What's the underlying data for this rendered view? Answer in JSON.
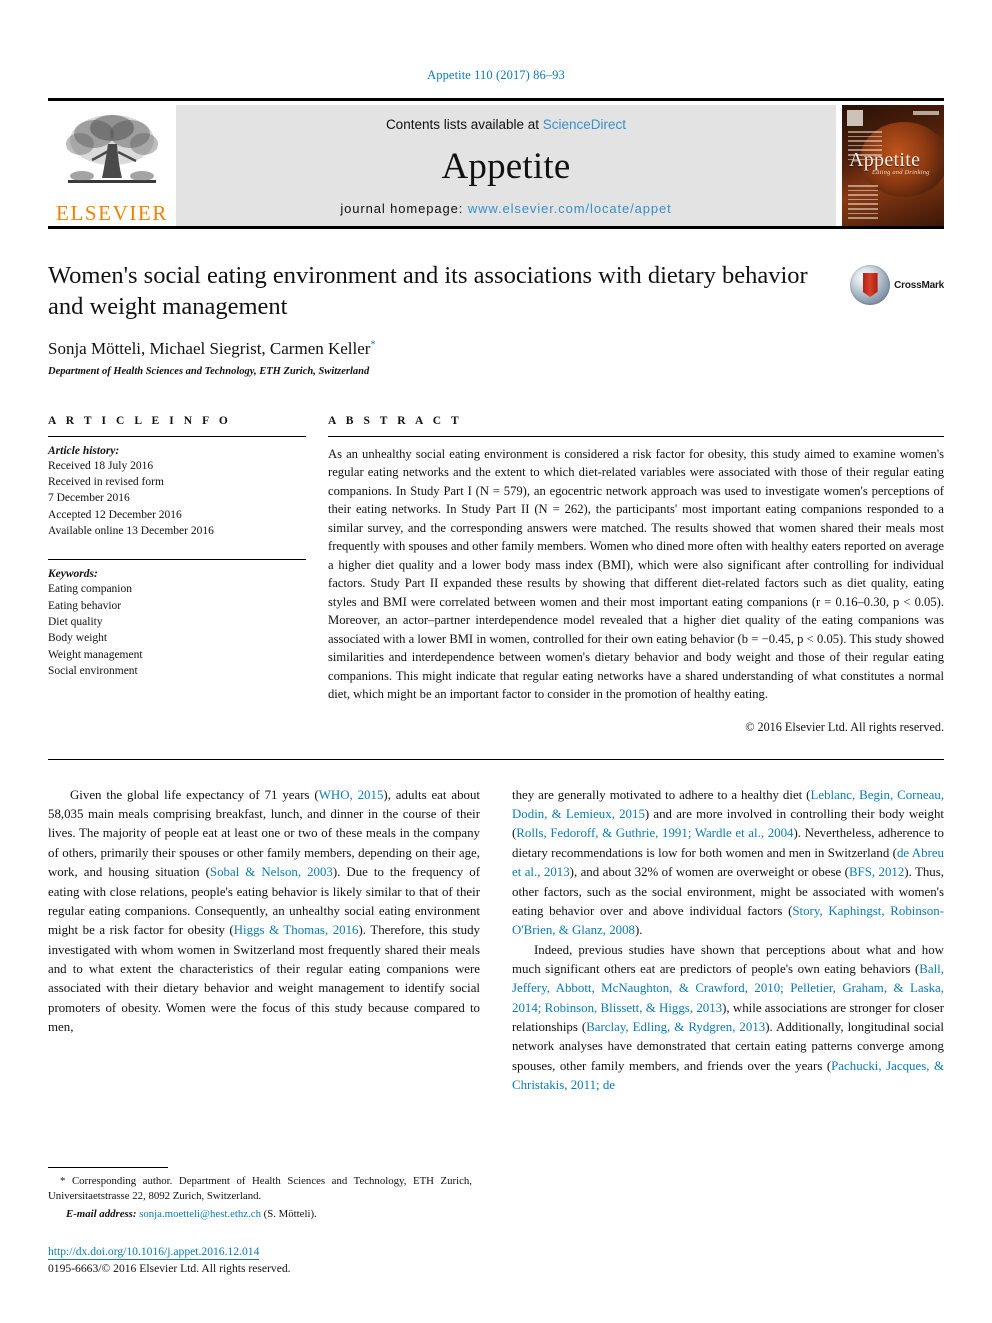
{
  "running_head": "Appetite 110 (2017) 86–93",
  "banner": {
    "publisher_name": "ELSEVIER",
    "contents_prefix": "Contents lists available at ",
    "contents_link": "ScienceDirect",
    "journal_name": "Appetite",
    "homepage_prefix": "journal homepage: ",
    "homepage_url": "www.elsevier.com/locate/appet",
    "cover_title": "Appetite",
    "cover_subtitle": "Eating and Drinking"
  },
  "article": {
    "title": "Women's social eating environment and its associations with dietary behavior and weight management",
    "authors": "Sonja Mötteli, Michael Siegrist, Carmen Keller",
    "author_marker": "*",
    "affiliation": "Department of Health Sciences and Technology, ETH Zurich, Switzerland",
    "crossmark_label": "CrossMark"
  },
  "article_info": {
    "section_label": "A R T I C L E   I N F O",
    "history_label": "Article history:",
    "history": [
      "Received 18 July 2016",
      "Received in revised form",
      "7 December 2016",
      "Accepted 12 December 2016",
      "Available online 13 December 2016"
    ],
    "keywords_label": "Keywords:",
    "keywords": [
      "Eating companion",
      "Eating behavior",
      "Diet quality",
      "Body weight",
      "Weight management",
      "Social environment"
    ]
  },
  "abstract": {
    "section_label": "A B S T R A C T",
    "text": "As an unhealthy social eating environment is considered a risk factor for obesity, this study aimed to examine women's regular eating networks and the extent to which diet-related variables were associated with those of their regular eating companions. In Study Part I (N = 579), an egocentric network approach was used to investigate women's perceptions of their eating networks. In Study Part II (N = 262), the participants' most important eating companions responded to a similar survey, and the corresponding answers were matched. The results showed that women shared their meals most frequently with spouses and other family members. Women who dined more often with healthy eaters reported on average a higher diet quality and a lower body mass index (BMI), which were also significant after controlling for individual factors. Study Part II expanded these results by showing that different diet-related factors such as diet quality, eating styles and BMI were correlated between women and their most important eating companions (r = 0.16–0.30, p < 0.05). Moreover, an actor–partner interdependence model revealed that a higher diet quality of the eating companions was associated with a lower BMI in women, controlled for their own eating behavior (b = −0.45, p < 0.05). This study showed similarities and interdependence between women's dietary behavior and body weight and those of their regular eating companions. This might indicate that regular eating networks have a shared understanding of what constitutes a normal diet, which might be an important factor to consider in the promotion of healthy eating.",
    "copyright": "© 2016 Elsevier Ltd. All rights reserved."
  },
  "body": {
    "left_paragraph_1": {
      "segments": [
        {
          "t": "Given the global life expectancy of 71 years (",
          "cite": false
        },
        {
          "t": "WHO, 2015",
          "cite": true
        },
        {
          "t": "), adults eat about 58,035 main meals comprising breakfast, lunch, and dinner in the course of their lives. The majority of people eat at least one or two of these meals in the company of others, primarily their spouses or other family members, depending on their age, work, and housing situation (",
          "cite": false
        },
        {
          "t": "Sobal & Nelson, 2003",
          "cite": true
        },
        {
          "t": "). Due to the frequency of eating with close relations, people's eating behavior is likely similar to that of their regular eating companions. Consequently, an unhealthy social eating environment might be a risk factor for obesity (",
          "cite": false
        },
        {
          "t": "Higgs & Thomas, 2016",
          "cite": true
        },
        {
          "t": "). Therefore, this study investigated with whom women in Switzerland most frequently shared their meals and to what extent the characteristics of their regular eating companions were associated with their dietary behavior and weight management to identify social promoters of obesity. Women were the focus of this study because compared to men,",
          "cite": false
        }
      ]
    },
    "right_paragraph_1": {
      "segments": [
        {
          "t": "they are generally motivated to adhere to a healthy diet (",
          "cite": false
        },
        {
          "t": "Leblanc, Begin, Corneau, Dodin, & Lemieux, 2015",
          "cite": true
        },
        {
          "t": ") and are more involved in controlling their body weight (",
          "cite": false
        },
        {
          "t": "Rolls, Fedoroff, & Guthrie, 1991; Wardle et al., 2004",
          "cite": true
        },
        {
          "t": "). Nevertheless, adherence to dietary recommendations is low for both women and men in Switzerland (",
          "cite": false
        },
        {
          "t": "de Abreu et al., 2013",
          "cite": true
        },
        {
          "t": "), and about 32% of women are overweight or obese (",
          "cite": false
        },
        {
          "t": "BFS, 2012",
          "cite": true
        },
        {
          "t": "). Thus, other factors, such as the social environment, might be associated with women's eating behavior over and above individual factors (",
          "cite": false
        },
        {
          "t": "Story, Kaphingst, Robinson-O'Brien, & Glanz, 2008",
          "cite": true
        },
        {
          "t": ").",
          "cite": false
        }
      ]
    },
    "right_paragraph_2": {
      "segments": [
        {
          "t": "Indeed, previous studies have shown that perceptions about what and how much significant others eat are predictors of people's own eating behaviors (",
          "cite": false
        },
        {
          "t": "Ball, Jeffery, Abbott, McNaughton, & Crawford, 2010; Pelletier, Graham, & Laska, 2014; Robinson, Blissett, & Higgs, 2013",
          "cite": true
        },
        {
          "t": "), while associations are stronger for closer relationships (",
          "cite": false
        },
        {
          "t": "Barclay, Edling, & Rydgren, 2013",
          "cite": true
        },
        {
          "t": "). Additionally, longitudinal social network analyses have demonstrated that certain eating patterns converge among spouses, other family members, and friends over the years (",
          "cite": false
        },
        {
          "t": "Pachucki, Jacques, & Christakis, 2011; de",
          "cite": true
        }
      ]
    }
  },
  "footer": {
    "corresponding": "* Corresponding author. Department of Health Sciences and Technology, ETH Zurich, Universitaetstrasse 22, 8092 Zurich, Switzerland.",
    "email_label": "E-mail address:",
    "email": "sonja.moetteli@hest.ethz.ch",
    "email_suffix": "(S. Mötteli).",
    "doi": "http://dx.doi.org/10.1016/j.appet.2016.12.014",
    "issn": "0195-6663/© 2016 Elsevier Ltd. All rights reserved."
  },
  "colors": {
    "link_blue": "#0b7ab5",
    "elsevier_orange": "#ef8200",
    "banner_gray": "#e3e3e3"
  }
}
